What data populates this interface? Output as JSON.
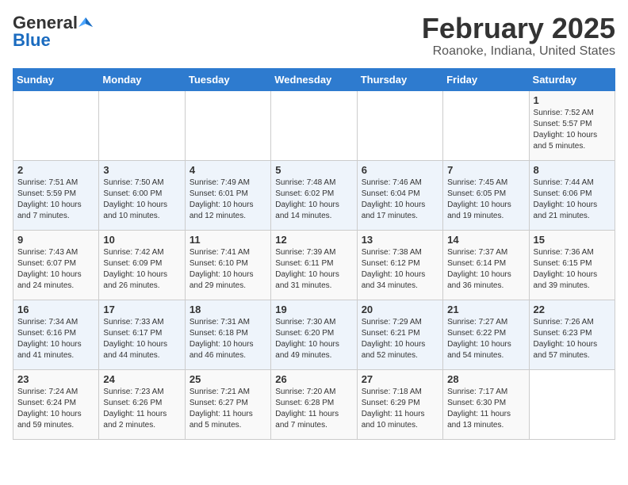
{
  "header": {
    "logo_general": "General",
    "logo_blue": "Blue",
    "title": "February 2025",
    "subtitle": "Roanoke, Indiana, United States"
  },
  "days_of_week": [
    "Sunday",
    "Monday",
    "Tuesday",
    "Wednesday",
    "Thursday",
    "Friday",
    "Saturday"
  ],
  "weeks": [
    {
      "days": [
        {
          "num": "",
          "info": ""
        },
        {
          "num": "",
          "info": ""
        },
        {
          "num": "",
          "info": ""
        },
        {
          "num": "",
          "info": ""
        },
        {
          "num": "",
          "info": ""
        },
        {
          "num": "",
          "info": ""
        },
        {
          "num": "1",
          "info": "Sunrise: 7:52 AM\nSunset: 5:57 PM\nDaylight: 10 hours\nand 5 minutes."
        }
      ]
    },
    {
      "days": [
        {
          "num": "2",
          "info": "Sunrise: 7:51 AM\nSunset: 5:59 PM\nDaylight: 10 hours\nand 7 minutes."
        },
        {
          "num": "3",
          "info": "Sunrise: 7:50 AM\nSunset: 6:00 PM\nDaylight: 10 hours\nand 10 minutes."
        },
        {
          "num": "4",
          "info": "Sunrise: 7:49 AM\nSunset: 6:01 PM\nDaylight: 10 hours\nand 12 minutes."
        },
        {
          "num": "5",
          "info": "Sunrise: 7:48 AM\nSunset: 6:02 PM\nDaylight: 10 hours\nand 14 minutes."
        },
        {
          "num": "6",
          "info": "Sunrise: 7:46 AM\nSunset: 6:04 PM\nDaylight: 10 hours\nand 17 minutes."
        },
        {
          "num": "7",
          "info": "Sunrise: 7:45 AM\nSunset: 6:05 PM\nDaylight: 10 hours\nand 19 minutes."
        },
        {
          "num": "8",
          "info": "Sunrise: 7:44 AM\nSunset: 6:06 PM\nDaylight: 10 hours\nand 21 minutes."
        }
      ]
    },
    {
      "days": [
        {
          "num": "9",
          "info": "Sunrise: 7:43 AM\nSunset: 6:07 PM\nDaylight: 10 hours\nand 24 minutes."
        },
        {
          "num": "10",
          "info": "Sunrise: 7:42 AM\nSunset: 6:09 PM\nDaylight: 10 hours\nand 26 minutes."
        },
        {
          "num": "11",
          "info": "Sunrise: 7:41 AM\nSunset: 6:10 PM\nDaylight: 10 hours\nand 29 minutes."
        },
        {
          "num": "12",
          "info": "Sunrise: 7:39 AM\nSunset: 6:11 PM\nDaylight: 10 hours\nand 31 minutes."
        },
        {
          "num": "13",
          "info": "Sunrise: 7:38 AM\nSunset: 6:12 PM\nDaylight: 10 hours\nand 34 minutes."
        },
        {
          "num": "14",
          "info": "Sunrise: 7:37 AM\nSunset: 6:14 PM\nDaylight: 10 hours\nand 36 minutes."
        },
        {
          "num": "15",
          "info": "Sunrise: 7:36 AM\nSunset: 6:15 PM\nDaylight: 10 hours\nand 39 minutes."
        }
      ]
    },
    {
      "days": [
        {
          "num": "16",
          "info": "Sunrise: 7:34 AM\nSunset: 6:16 PM\nDaylight: 10 hours\nand 41 minutes."
        },
        {
          "num": "17",
          "info": "Sunrise: 7:33 AM\nSunset: 6:17 PM\nDaylight: 10 hours\nand 44 minutes."
        },
        {
          "num": "18",
          "info": "Sunrise: 7:31 AM\nSunset: 6:18 PM\nDaylight: 10 hours\nand 46 minutes."
        },
        {
          "num": "19",
          "info": "Sunrise: 7:30 AM\nSunset: 6:20 PM\nDaylight: 10 hours\nand 49 minutes."
        },
        {
          "num": "20",
          "info": "Sunrise: 7:29 AM\nSunset: 6:21 PM\nDaylight: 10 hours\nand 52 minutes."
        },
        {
          "num": "21",
          "info": "Sunrise: 7:27 AM\nSunset: 6:22 PM\nDaylight: 10 hours\nand 54 minutes."
        },
        {
          "num": "22",
          "info": "Sunrise: 7:26 AM\nSunset: 6:23 PM\nDaylight: 10 hours\nand 57 minutes."
        }
      ]
    },
    {
      "days": [
        {
          "num": "23",
          "info": "Sunrise: 7:24 AM\nSunset: 6:24 PM\nDaylight: 10 hours\nand 59 minutes."
        },
        {
          "num": "24",
          "info": "Sunrise: 7:23 AM\nSunset: 6:26 PM\nDaylight: 11 hours\nand 2 minutes."
        },
        {
          "num": "25",
          "info": "Sunrise: 7:21 AM\nSunset: 6:27 PM\nDaylight: 11 hours\nand 5 minutes."
        },
        {
          "num": "26",
          "info": "Sunrise: 7:20 AM\nSunset: 6:28 PM\nDaylight: 11 hours\nand 7 minutes."
        },
        {
          "num": "27",
          "info": "Sunrise: 7:18 AM\nSunset: 6:29 PM\nDaylight: 11 hours\nand 10 minutes."
        },
        {
          "num": "28",
          "info": "Sunrise: 7:17 AM\nSunset: 6:30 PM\nDaylight: 11 hours\nand 13 minutes."
        },
        {
          "num": "",
          "info": ""
        }
      ]
    }
  ]
}
